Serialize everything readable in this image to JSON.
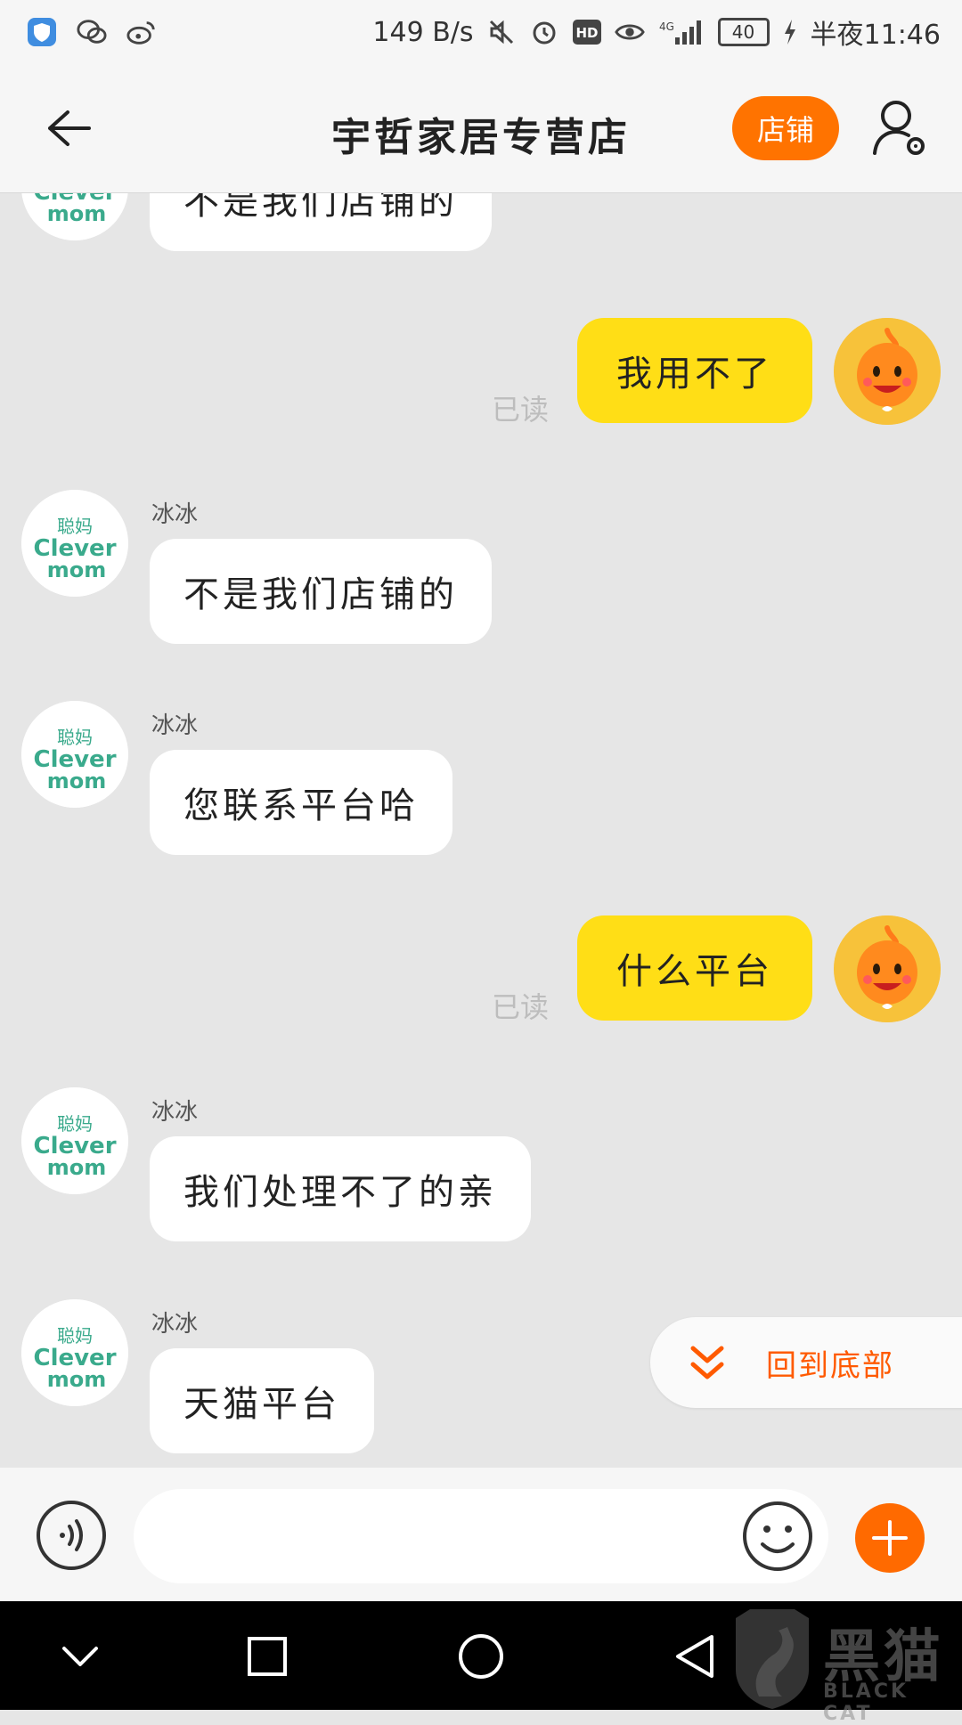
{
  "status_bar": {
    "net_speed": "149 B/s",
    "hd": "HD",
    "signal_label": "4G",
    "battery": "40",
    "time": "半夜11:46",
    "left_icons": [
      "shield-app-icon",
      "wechat-icon",
      "weibo-icon"
    ],
    "right_icons": [
      "mute-icon",
      "alarm-icon",
      "hd-icon",
      "eye-icon",
      "signal-icon",
      "battery-icon",
      "charging-icon"
    ]
  },
  "header": {
    "title": "宇哲家居专营店",
    "shop_button": "店铺",
    "icons": [
      "back-arrow-icon",
      "user-settings-icon"
    ]
  },
  "messages": [
    {
      "side": "in",
      "sender": "",
      "text": "不是我们店铺的",
      "partial": true
    },
    {
      "side": "out",
      "text": "我用不了",
      "status": "已读"
    },
    {
      "side": "in",
      "sender": "冰冰",
      "text": "不是我们店铺的"
    },
    {
      "side": "in",
      "sender": "冰冰",
      "text": "您联系平台哈"
    },
    {
      "side": "out",
      "text": "什么平台",
      "status": "已读"
    },
    {
      "side": "in",
      "sender": "冰冰",
      "text": "我们处理不了的亲"
    },
    {
      "side": "in",
      "sender": "冰冰",
      "text": "天猫平台"
    }
  ],
  "avatar_text": {
    "line1": "聪妈",
    "line2": "Clever",
    "line3": "mom"
  },
  "jump_to_bottom": "回到底部",
  "input": {
    "value": "",
    "placeholder": ""
  },
  "watermark": {
    "text": "黑猫",
    "sub": "BLACK CAT"
  },
  "colors": {
    "accent": "#ff7300",
    "outgoing_bubble": "#ffde16",
    "incoming_bubble": "#ffffff",
    "chat_background": "#e6e6e6",
    "avatar_green": "#3aaa8c"
  }
}
